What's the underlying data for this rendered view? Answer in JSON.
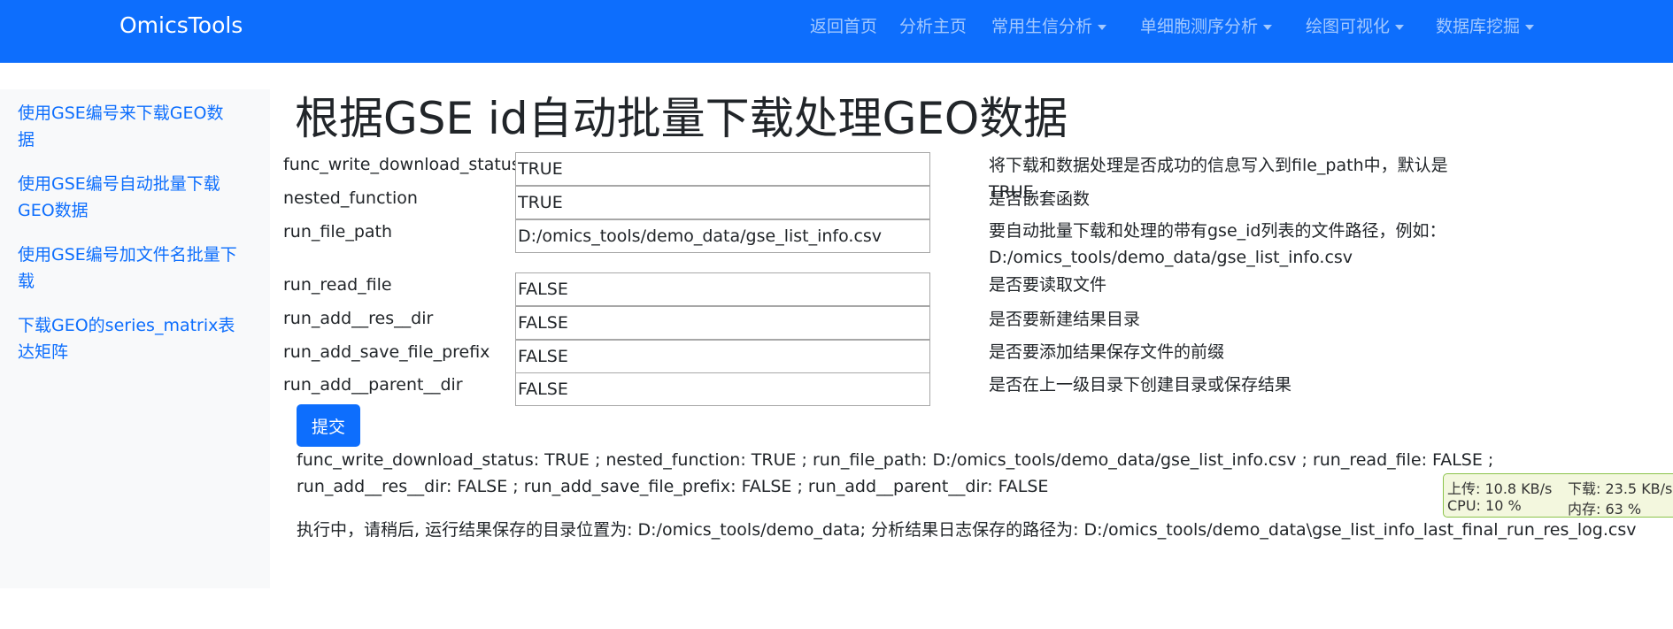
{
  "navbar": {
    "brand": "OmicsTools",
    "items": [
      {
        "label": "返回首页"
      },
      {
        "label": "分析主页"
      },
      {
        "label": "常用生信分析"
      },
      {
        "label": "单细胞测序分析"
      },
      {
        "label": "绘图可视化"
      },
      {
        "label": "数据库挖掘"
      }
    ]
  },
  "sidebar": {
    "items": [
      {
        "label": "使用GSE编号来下载GEO数据"
      },
      {
        "label": "使用GSE编号自动批量下载GEO数据"
      },
      {
        "label": "使用GSE编号加文件名批量下载"
      },
      {
        "label": "下载GEO的series_matrix表达矩阵"
      }
    ]
  },
  "page_title": "根据GSE id自动批量下载处理GEO数据",
  "params": [
    {
      "label": "func_write_download_status",
      "value": "TRUE",
      "desc": "将下载和数据处理是否成功的信息写入到file_path中，默认是TRUE"
    },
    {
      "label": "nested_function",
      "value": "TRUE",
      "desc": "是否嵌套函数"
    },
    {
      "label": "run_file_path",
      "value": "D:/omics_tools/demo_data/gse_list_info.csv",
      "desc": "要自动批量下载和处理的带有gse_id列表的文件路径，例如：D:/omics_tools/demo_data/gse_list_info.csv"
    },
    {
      "label": "run_read_file",
      "value": "FALSE",
      "desc": "是否要读取文件"
    },
    {
      "label": "run_add__res__dir",
      "value": "FALSE",
      "desc": "是否要新建结果目录"
    },
    {
      "label": "run_add_save_file_prefix",
      "value": "FALSE",
      "desc": "是否要添加结果保存文件的前缀"
    },
    {
      "label": "run_add__parent__dir",
      "value": "FALSE",
      "desc": "是否在上一级目录下创建目录或保存结果"
    }
  ],
  "submit_label": "提交",
  "result_summary": "func_write_download_status: TRUE ; nested_function: TRUE ; run_file_path: D:/omics_tools/demo_data/gse_list_info.csv ; run_read_file: FALSE ; run_add__res__dir: FALSE ; run_add_save_file_prefix: FALSE ; run_add__parent__dir: FALSE",
  "result_status": "执行中，请稍后, 运行结果保存的目录位置为: D:/omics_tools/demo_data; 分析结果日志保存的路径为: D:/omics_tools/demo_data\\gse_list_info_last_final_run_res_log.csv",
  "net_monitor": {
    "upload": "上传: 10.8 KB/s",
    "download": "下载: 23.5 KB/s",
    "cpu": "CPU: 10 %",
    "memory": "内存: 63 %"
  }
}
